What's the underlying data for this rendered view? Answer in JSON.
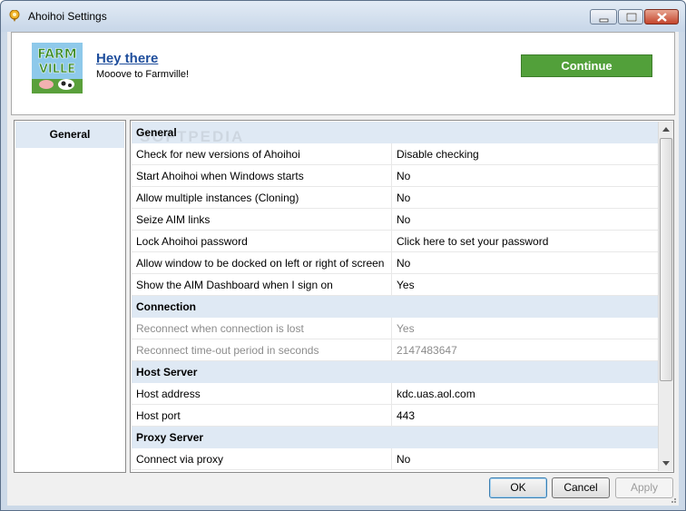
{
  "window": {
    "title": "Ahoihoi Settings"
  },
  "banner": {
    "title": "Hey there",
    "subtitle": "Mooove to Farmville!",
    "continue_label": "Continue",
    "logo_text_line1": "FARM",
    "logo_text_line2": "VILLE",
    "continue_color": "#52a03a"
  },
  "sidebar": {
    "items": [
      {
        "label": "General"
      }
    ]
  },
  "watermark": "SOFTPEDIA",
  "settings": [
    {
      "type": "category",
      "label": "General"
    },
    {
      "key": "Check for new versions of Ahoihoi",
      "value": "Disable checking"
    },
    {
      "key": "Start Ahoihoi when Windows starts",
      "value": "No"
    },
    {
      "key": "Allow multiple instances (Cloning)",
      "value": "No"
    },
    {
      "key": "Seize AIM links",
      "value": "No"
    },
    {
      "key": "Lock Ahoihoi password",
      "value": "Click here to set your password"
    },
    {
      "key": "Allow window to be docked on left or right of screen",
      "value": "No"
    },
    {
      "key": "Show the AIM Dashboard when I sign on",
      "value": "Yes"
    },
    {
      "type": "category",
      "label": "Connection"
    },
    {
      "key": "Reconnect when connection is lost",
      "value": "Yes",
      "disabled": true
    },
    {
      "key": "Reconnect time-out period in seconds",
      "value": "2147483647",
      "disabled": true
    },
    {
      "type": "category",
      "label": "Host Server"
    },
    {
      "key": "Host address",
      "value": "kdc.uas.aol.com"
    },
    {
      "key": "Host port",
      "value": "443"
    },
    {
      "type": "category",
      "label": "Proxy Server"
    },
    {
      "key": "Connect via proxy",
      "value": "No"
    }
  ],
  "footer": {
    "ok_label": "OK",
    "cancel_label": "Cancel",
    "apply_label": "Apply"
  }
}
